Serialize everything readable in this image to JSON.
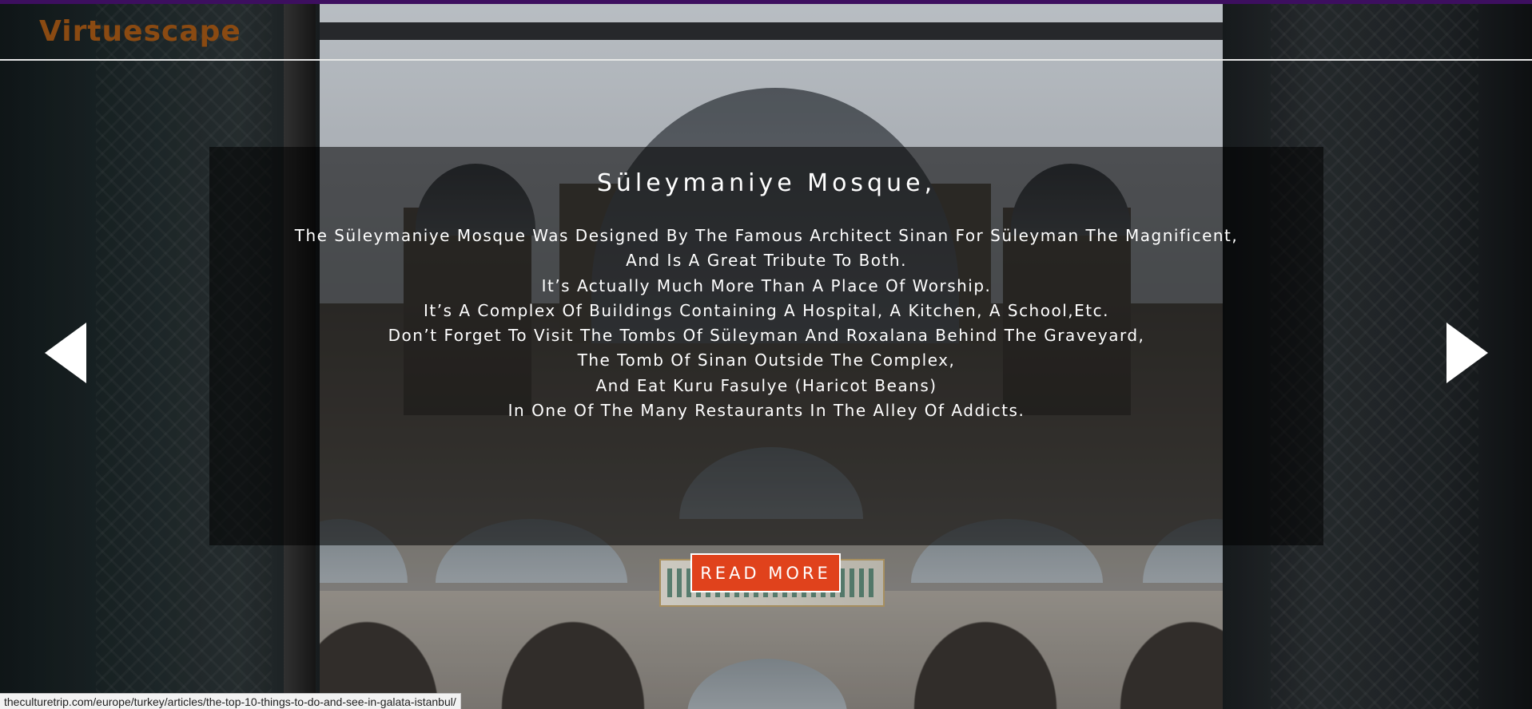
{
  "header": {
    "logo": "Virtuescape"
  },
  "slide": {
    "title": "Süleymaniye Mosque,",
    "description_lines": [
      "The Süleymaniye Mosque Was Designed By The Famous Architect Sinan For Süleyman The Magnificent,",
      "And Is A Great Tribute To Both.",
      "It’s Actually Much More Than A Place Of Worship.",
      "It’s A Complex Of Buildings Containing A Hospital, A Kitchen, A School,Etc.",
      "Don’t Forget To Visit The Tombs Of Süleyman And Roxalana Behind The Graveyard,",
      "The Tomb Of Sinan Outside The Complex,",
      "And Eat Kuru Fasulye (Haricot Beans)",
      "In One Of The Many Restaurants In The Alley Of Addicts."
    ],
    "button_label": "READ MORE",
    "prev_icon": "triangle-left-icon",
    "next_icon": "triangle-right-icon"
  },
  "status_bar": {
    "url": "theculturetrip.com/europe/turkey/articles/the-top-10-things-to-do-and-see-in-galata-istanbul/"
  },
  "colors": {
    "accent_bar": "#3d0f5f",
    "logo": "#8a4a12",
    "button": "#e0421c",
    "caption_overlay": "rgba(0,0,0,0.55)"
  }
}
